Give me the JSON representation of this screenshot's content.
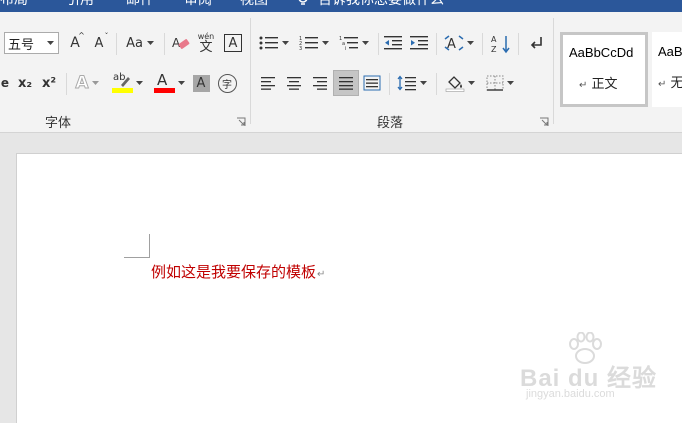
{
  "tabs": [
    {
      "label": "布局"
    },
    {
      "label": "引用"
    },
    {
      "label": "邮件"
    },
    {
      "label": "审阅"
    },
    {
      "label": "视图"
    }
  ],
  "tell_me": "告诉我你想要做什么",
  "font": {
    "size_value": "五号",
    "group_label": "字体",
    "font_color": "#ff0000",
    "highlight_color": "#ffff00",
    "text_effects_letter": "A",
    "font_color_letter": "A",
    "char_shading_letter": "A",
    "clear_format_letter": "Aa",
    "phonetic_top": "wén",
    "phonetic_bottom": "文",
    "char_border_letter": "A",
    "grow_letter": "A",
    "shrink_letter": "A",
    "subscript": "x₂",
    "superscript": "x²",
    "highlight_letters": "ab",
    "enclose_char": "字"
  },
  "paragraph": {
    "group_label": "段落"
  },
  "styles": {
    "items": [
      {
        "sample": "AaBbCcDd",
        "name": "正文",
        "mark": "↵"
      },
      {
        "sample": "AaBbC",
        "name": "无间隔",
        "mark": "↵"
      }
    ]
  },
  "document": {
    "text": "例如这是我要保存的模板",
    "paragraph_mark": "↵",
    "text_color": "#c00000"
  },
  "watermark": {
    "main": "Bai du 经验",
    "sub": "jingyan.baidu.com"
  }
}
